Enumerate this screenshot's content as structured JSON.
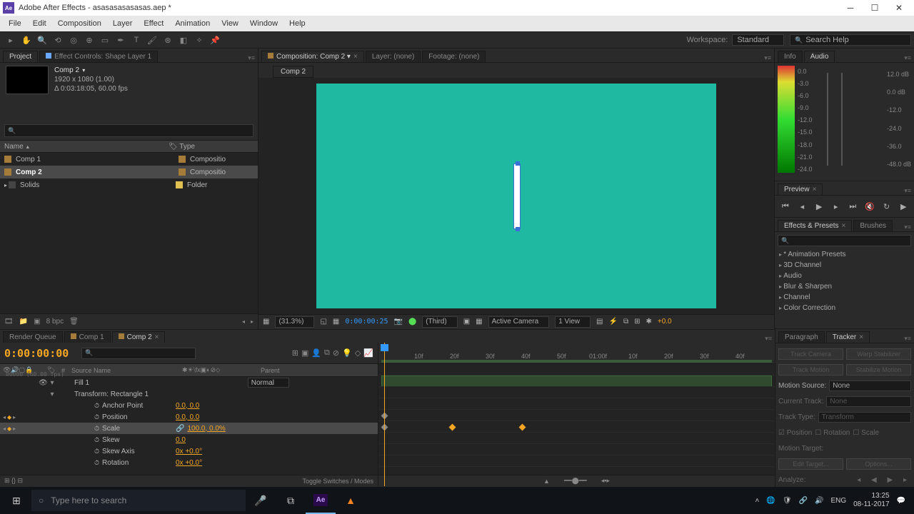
{
  "app": {
    "icon": "Ae",
    "title": "Adobe After Effects - asasasasasasas.aep *"
  },
  "menu": [
    "File",
    "Edit",
    "Composition",
    "Layer",
    "Effect",
    "Animation",
    "View",
    "Window",
    "Help"
  ],
  "workspace": {
    "label": "Workspace:",
    "value": "Standard",
    "search_placeholder": "Search Help"
  },
  "project": {
    "tab_project": "Project",
    "tab_effects": "Effect Controls: Shape Layer 1",
    "comp_name": "Comp 2",
    "comp_res": "1920 x 1080 (1.00)",
    "comp_dur": "Δ 0:03:18:05, 60.00 fps",
    "col_name": "Name",
    "col_type": "Type",
    "items": [
      {
        "name": "Comp 1",
        "type": "Compositio",
        "color": "#a57c3a",
        "tcolor": "#a57c3a"
      },
      {
        "name": "Comp 2",
        "type": "Compositio",
        "color": "#a57c3a",
        "tcolor": "#a57c3a",
        "selected": true
      },
      {
        "name": "Solids",
        "type": "Folder",
        "color": "#444",
        "tcolor": "#e0c050"
      }
    ],
    "bpc": "8 bpc"
  },
  "composition": {
    "panel_label": "Composition: Comp 2",
    "layer_label": "Layer: (none)",
    "footage_label": "Footage: (none)",
    "tab": "Comp 2",
    "zoom": "(31.3%)",
    "time": "0:00:00:25",
    "res": "(Third)",
    "camera": "Active Camera",
    "views": "1 View",
    "exposure": "+0.0"
  },
  "info": {
    "tab_info": "Info",
    "tab_audio": "Audio",
    "left_db": [
      "0.0",
      "-3.0",
      "-6.0",
      "-9.0",
      "-12.0",
      "-15.0",
      "-18.0",
      "-21.0",
      "-24.0"
    ],
    "right_db": [
      "12.0 dB",
      "0.0 dB",
      "-12.0",
      "-24.0",
      "-36.0",
      "-48.0 dB"
    ]
  },
  "preview": {
    "tab": "Preview"
  },
  "effects": {
    "tab_efx": "Effects & Presets",
    "tab_brush": "Brushes",
    "items": [
      "* Animation Presets",
      "3D Channel",
      "Audio",
      "Blur & Sharpen",
      "Channel",
      "Color Correction"
    ]
  },
  "timeline": {
    "tab_render": "Render Queue",
    "tab_c1": "Comp 1",
    "tab_c2": "Comp 2",
    "time": "0:00:00:00",
    "subtime": "00000 (60.00 fps)",
    "col_src": "Source Name",
    "col_parent": "Parent",
    "rows": [
      {
        "type": "fill",
        "name": "Fill 1",
        "mode": "Normal"
      },
      {
        "type": "group",
        "name": "Transform: Rectangle 1"
      },
      {
        "type": "prop",
        "name": "Anchor Point",
        "val": "0.0, 0.0"
      },
      {
        "type": "kprop",
        "name": "Position",
        "val": "0.0, 0.0"
      },
      {
        "type": "kprop",
        "name": "Scale",
        "val": "100.0, 0.0%",
        "selected": true
      },
      {
        "type": "prop",
        "name": "Skew",
        "val": "0.0"
      },
      {
        "type": "prop",
        "name": "Skew Axis",
        "val": "0x +0.0°"
      },
      {
        "type": "prop",
        "name": "Rotation",
        "val": "0x +0.0°"
      }
    ],
    "toggle_label": "Toggle Switches / Modes",
    "ruler": [
      "10f",
      "20f",
      "30f",
      "40f",
      "50f",
      "01:00f",
      "10f",
      "20f",
      "30f",
      "40f"
    ]
  },
  "tracker": {
    "tab_para": "Paragraph",
    "tab_tracker": "Tracker",
    "btn_tc": "Track Camera",
    "btn_ws": "Warp Stabilizer",
    "btn_tm": "Track Motion",
    "btn_sm": "Stabilize Motion",
    "motion_source_label": "Motion Source:",
    "motion_source": "None",
    "current_track_label": "Current Track:",
    "current_track": "None",
    "track_type_label": "Track Type:",
    "track_type": "Transform",
    "cb_pos": "Position",
    "cb_rot": "Rotation",
    "cb_scale": "Scale",
    "motion_target": "Motion Target:",
    "btn_edit": "Edit Target...",
    "btn_opt": "Options...",
    "analyze": "Analyze:"
  },
  "taskbar": {
    "search": "Type here to search",
    "lang": "ENG",
    "time": "13:25",
    "date": "08-11-2017"
  }
}
